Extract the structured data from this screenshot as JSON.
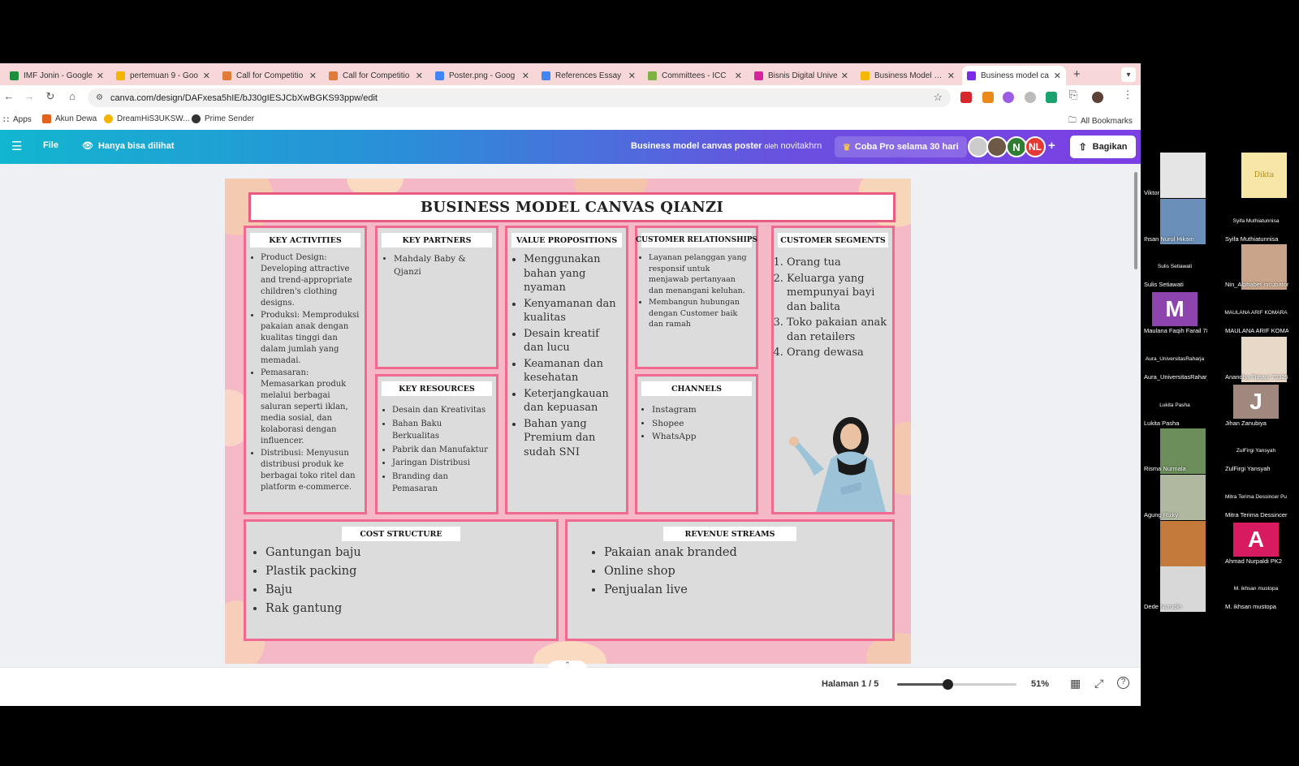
{
  "tabs": [
    {
      "title": "IMF Jonin - Google",
      "favicon": "sheets-icon",
      "color": "#1e8e3e"
    },
    {
      "title": "pertemuan 9 - Goo",
      "favicon": "slides-icon",
      "color": "#f4b400"
    },
    {
      "title": "Call for Competitio",
      "favicon": "site-icon",
      "color": "#e07b39"
    },
    {
      "title": "Call for Competitio",
      "favicon": "site-icon",
      "color": "#e07b39"
    },
    {
      "title": "Poster.png - Goog",
      "favicon": "drive-icon",
      "color": "#4285f4"
    },
    {
      "title": "References Essay",
      "favicon": "drive-icon",
      "color": "#4285f4"
    },
    {
      "title": "Committees - ICC",
      "favicon": "site-icon",
      "color": "#7cb342"
    },
    {
      "title": "Bisnis Digital Unive",
      "favicon": "instagram-icon",
      "color": "#d6249f"
    },
    {
      "title": "Business Model Ca",
      "favicon": "site-icon",
      "color": "#f5b800"
    },
    {
      "title": "Business model ca",
      "favicon": "canva-icon",
      "color": "#7d2ae8",
      "active": true
    }
  ],
  "url": "canva.com/design/DAFxesa5hIE/bJ30gIESJCbXwBGKS93ppw/edit",
  "bookmarks": {
    "apps": "Apps",
    "items": [
      "Akun Dewa",
      "DreamHiS3UKSW...",
      "Prime Sender"
    ],
    "all": "All Bookmarks"
  },
  "canva": {
    "file": "File",
    "view_only": "Hanya bisa dilihat",
    "doc_title": "Business model canvas poster",
    "by": "oleh",
    "author": "novitakhrn",
    "pro": "Coba Pro selama 30 hari",
    "avatars": [
      "N",
      "NL"
    ],
    "share": "Bagikan"
  },
  "poster": {
    "title": "BUSINESS MODEL CANVAS QIANZI",
    "key_activities": {
      "header": "KEY ACTIVITIES",
      "items": [
        "Product Design: Developing attractive and trend-appropriate children's clothing designs.",
        "Produksi: Memproduksi pakaian anak dengan kualitas tinggi dan dalam jumlah yang memadai.",
        "Pemasaran: Memasarkan produk melalui berbagai saluran seperti iklan, media sosial, dan kolaborasi dengan influencer.",
        "Distribusi: Menyusun distribusi produk ke berbagai toko ritel dan platform e-commerce."
      ]
    },
    "key_partners": {
      "header": "KEY PARTNERS",
      "items": [
        "Mahdaly Baby & Qjanzi"
      ]
    },
    "key_resources": {
      "header": "KEY RESOURCES",
      "items": [
        "Desain dan Kreativitas",
        "Bahan Baku Berkualitas",
        "Pabrik dan Manufaktur",
        "Jaringan Distribusi",
        "Branding dan Pemasaran"
      ]
    },
    "value_propositions": {
      "header": "VALUE PROPOSITIONS",
      "items": [
        "Menggunakan bahan yang nyaman",
        "Kenyamanan dan kualitas",
        "Desain kreatif dan lucu",
        "Keamanan dan kesehatan",
        "Keterjangkauan dan kepuasan",
        "Bahan yang Premium dan sudah SNI"
      ]
    },
    "customer_relationships": {
      "header": "CUSTOMER RELATIONSHIPS",
      "items": [
        "Layanan pelanggan yang responsif untuk menjawab pertanyaan dan menangani keluhan.",
        "Membangun hubungan dengan Customer baik dan ramah"
      ]
    },
    "channels": {
      "header": "CHANNELS",
      "items": [
        "Instagram",
        "Shopee",
        "WhatsApp"
      ]
    },
    "customer_segments": {
      "header": "CUSTOMER SEGMENTS",
      "items": [
        "Orang tua",
        "Keluarga yang mempunyai bayi dan balita",
        "Toko pakaian anak dan retailers",
        "Orang dewasa"
      ]
    },
    "cost_structure": {
      "header": "COST STRUCTURE",
      "items": [
        "Gantungan baju",
        "Plastik packing",
        "Baju",
        "Rak gantung"
      ]
    },
    "revenue_streams": {
      "header": "REVENUE STREAMS",
      "items": [
        "Pakaian anak branded",
        "Online shop",
        "Penjualan live"
      ]
    }
  },
  "footer": {
    "page": "Halaman 1 / 5",
    "zoom": "51%",
    "zoom_fraction": 0.42
  },
  "participants": [
    {
      "name": "Viktor",
      "kind": "photo",
      "bg": "#e5e5e5"
    },
    {
      "name": "",
      "label": "Dikta",
      "kind": "logo",
      "bg": "#f6e7a8"
    },
    {
      "name": "Ihsan Nurul Hikam",
      "kind": "photo",
      "bg": "#6a8fb8"
    },
    {
      "name": "Syifa Muthiatunnisa",
      "center": "Syifa Muthiatunnisa",
      "kind": "name"
    },
    {
      "name": "Sulis Setiawati",
      "center": "Sulis Setiawati",
      "kind": "name"
    },
    {
      "name": "Nin_Alphabet Incubator",
      "kind": "photo",
      "bg": "#c9a48a"
    },
    {
      "name": "Maulana Faqih Farail 78123",
      "letter": "M",
      "kind": "letter",
      "bg": "#8e44ad"
    },
    {
      "name": "MAULANA ARIF KOMARA",
      "center": "MAULANA ARIF KOMARA",
      "kind": "name"
    },
    {
      "name": "Aura_UniversitasRaharja",
      "center": "Aura_UniversitasRaharja",
      "kind": "name"
    },
    {
      "name": "Anandha Fitriani 75325",
      "kind": "photo",
      "bg": "#e8d8c8"
    },
    {
      "name": "Lukita Pasha",
      "center": "Lukita Pasha",
      "kind": "name"
    },
    {
      "name": "Jihan Zanubiya",
      "letter": "J",
      "kind": "letter",
      "bg": "#a1887f"
    },
    {
      "name": "Risma Nurmala",
      "kind": "photo",
      "bg": "#6b8e5a"
    },
    {
      "name": "ZulFirgi Yansyah",
      "center": "ZulFirgi Yansyah",
      "kind": "name"
    },
    {
      "name": "Agung Rizky",
      "kind": "photo",
      "bg": "#b0b8a0"
    },
    {
      "name": "Mitra Terima Dessincer Pu",
      "center": "Mitra Terima Dessincer Pu",
      "kind": "name"
    },
    {
      "name": "",
      "kind": "photo",
      "bg": "#c47a3a"
    },
    {
      "name": "Ahmad Nurpaldi PK2",
      "letter": "A",
      "kind": "letter",
      "bg": "#d81b60"
    },
    {
      "name": "Dede Nurudin",
      "kind": "photo",
      "bg": "#d8d8d8"
    },
    {
      "name": "M. ikhsan mustopa",
      "center": "M. ikhsan mustopa",
      "kind": "name"
    }
  ]
}
